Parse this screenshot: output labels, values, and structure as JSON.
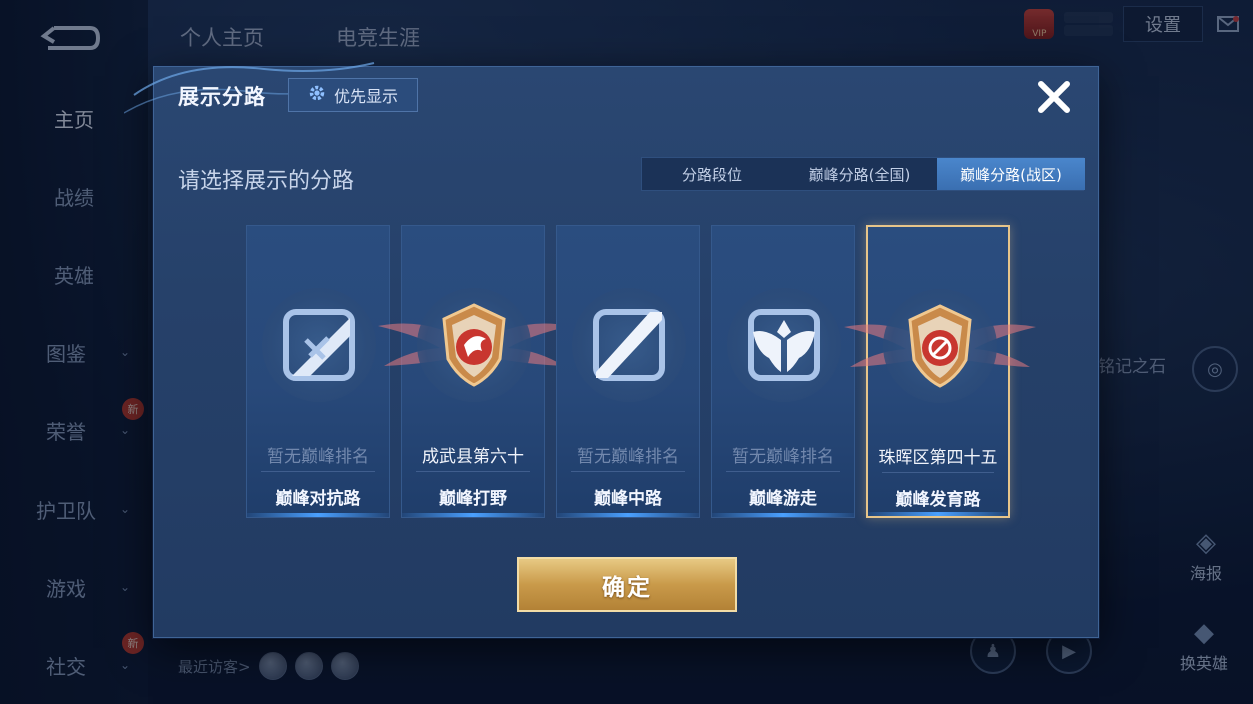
{
  "background": {
    "sidebar": [
      {
        "label": "主页",
        "active": true
      },
      {
        "label": "战绩"
      },
      {
        "label": "英雄"
      },
      {
        "label": "图鉴",
        "chevron": true
      },
      {
        "label": "荣誉",
        "chevron": true,
        "badge": "新"
      },
      {
        "label": "护卫队",
        "chevron": true
      },
      {
        "label": "游戏",
        "chevron": true
      },
      {
        "label": "社交",
        "chevron": true,
        "badge": "新"
      }
    ],
    "top_tabs": [
      "个人主页",
      "电竞生涯"
    ],
    "settings_label": "设置",
    "vip_label": "VIP",
    "recent_visitors_label": "最近访客>",
    "stone_label": "铭记之石",
    "poster_label": "海报",
    "change_hero_label": "换英雄"
  },
  "dialog": {
    "title": "展示分路",
    "priority_button": "优先显示",
    "prompt": "请选择展示的分路",
    "segments": [
      {
        "label": "分路段位",
        "active": false
      },
      {
        "label": "巅峰分路(全国)",
        "active": false
      },
      {
        "label": "巅峰分路(战区)",
        "active": true
      }
    ],
    "cards": [
      {
        "rank": "暂无巅峰排名",
        "lane": "巅峰对抗路",
        "icon": "clash-lane-icon",
        "ranked": false,
        "selected": false
      },
      {
        "rank": "成武县第六十",
        "lane": "巅峰打野",
        "icon": "jungle-emblem-icon",
        "ranked": true,
        "selected": false
      },
      {
        "rank": "暂无巅峰排名",
        "lane": "巅峰中路",
        "icon": "mid-lane-icon",
        "ranked": false,
        "selected": false
      },
      {
        "rank": "暂无巅峰排名",
        "lane": "巅峰游走",
        "icon": "roam-icon",
        "ranked": false,
        "selected": false
      },
      {
        "rank": "珠晖区第四十五",
        "lane": "巅峰发育路",
        "icon": "farm-lane-emblem-icon",
        "ranked": true,
        "selected": true
      }
    ],
    "confirm_button": "确定"
  }
}
